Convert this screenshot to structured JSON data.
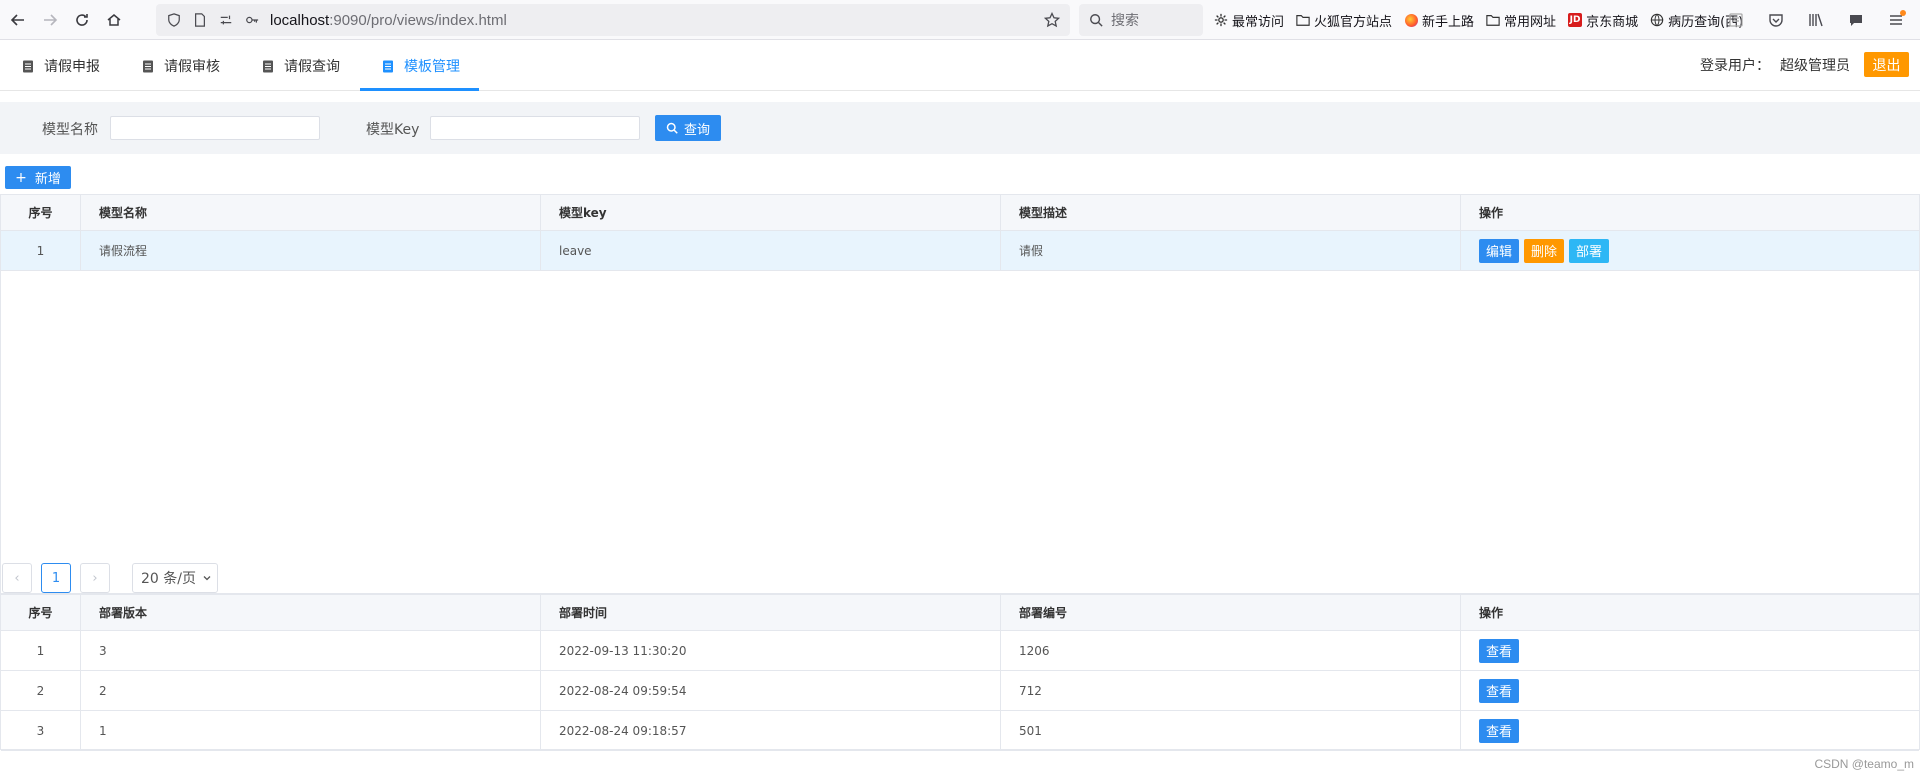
{
  "browser": {
    "url_host": "localhost",
    "url_rest": ":9090/pro/views/index.html",
    "search_placeholder": "搜索",
    "bookmarks": [
      {
        "label": "最常访问",
        "icon": "gear-icon"
      },
      {
        "label": "火狐官方站点",
        "icon": "folder-icon"
      },
      {
        "label": "新手上路",
        "icon": "firefox-icon"
      },
      {
        "label": "常用网址",
        "icon": "folder-icon"
      },
      {
        "label": "京东商城",
        "icon": "jd-icon",
        "badge": "JD"
      },
      {
        "label": "病历查询(西)",
        "icon": "globe-icon"
      }
    ]
  },
  "app": {
    "tabs": [
      {
        "label": "请假申报"
      },
      {
        "label": "请假审核"
      },
      {
        "label": "请假查询"
      },
      {
        "label": "模板管理"
      }
    ],
    "active_tab": "模板管理",
    "user_label": "登录用户：",
    "user_name": "超级管理员",
    "logout_label": "退出",
    "accent": "#1e90ff",
    "warning": "#ff9800"
  },
  "search": {
    "name_label": "模型名称",
    "name_value": "",
    "key_label": "模型Key",
    "key_value": "",
    "query_label": "查询"
  },
  "add_label": "新增",
  "model_table": {
    "headers": [
      "序号",
      "模型名称",
      "模型key",
      "模型描述",
      "操作"
    ],
    "rows": [
      {
        "no": "1",
        "name": "请假流程",
        "key": "leave",
        "desc": "请假",
        "edit": "编辑",
        "delete": "删除",
        "deploy": "部署"
      }
    ]
  },
  "pagination": {
    "current_page": "1",
    "page_size": "20 条/页",
    "prev": "‹",
    "next": "›"
  },
  "deploy_table": {
    "headers": [
      "序号",
      "部署版本",
      "部署时间",
      "部署编号",
      "操作"
    ],
    "rows": [
      {
        "no": "1",
        "version": "3",
        "time": "2022-09-13 11:30:20",
        "id": "1206",
        "action": "查看"
      },
      {
        "no": "2",
        "version": "2",
        "time": "2022-08-24 09:59:54",
        "id": "712",
        "action": "查看"
      },
      {
        "no": "3",
        "version": "1",
        "time": "2022-08-24 09:18:57",
        "id": "501",
        "action": "查看"
      }
    ]
  },
  "watermark": "CSDN @teamo_m"
}
